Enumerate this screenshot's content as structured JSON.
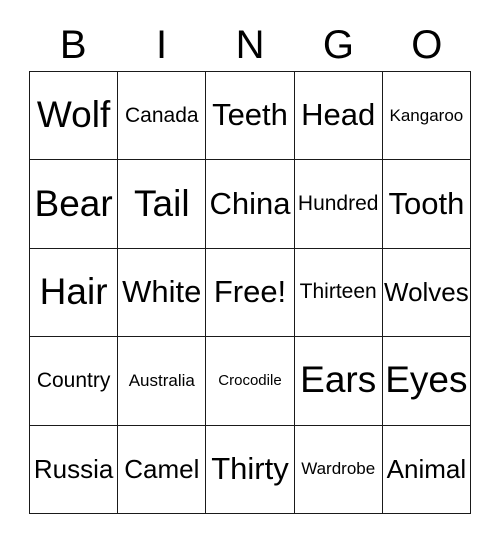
{
  "card": {
    "title": "BINGO",
    "header_letters": [
      "B",
      "I",
      "N",
      "G",
      "O"
    ],
    "border_color": "#1a1a1a",
    "background_color": "#ffffff",
    "text_color": "#000000",
    "columns": 5,
    "rows": 5,
    "free_space_label": "Free!",
    "cells": [
      [
        {
          "label": "Wolf",
          "size": "fs-xl"
        },
        {
          "label": "Canada",
          "size": "fs-sm"
        },
        {
          "label": "Teeth",
          "size": "fs-lg"
        },
        {
          "label": "Head",
          "size": "fs-lg"
        },
        {
          "label": "Kangaroo",
          "size": "fs-xs"
        }
      ],
      [
        {
          "label": "Bear",
          "size": "fs-xl"
        },
        {
          "label": "Tail",
          "size": "fs-xl"
        },
        {
          "label": "China",
          "size": "fs-lg"
        },
        {
          "label": "Hundred",
          "size": "fs-sm"
        },
        {
          "label": "Tooth",
          "size": "fs-lg"
        }
      ],
      [
        {
          "label": "Hair",
          "size": "fs-xl"
        },
        {
          "label": "White",
          "size": "fs-lg"
        },
        {
          "label": "Free!",
          "size": "fs-lg"
        },
        {
          "label": "Thirteen",
          "size": "fs-sm"
        },
        {
          "label": "Wolves",
          "size": "fs-md"
        }
      ],
      [
        {
          "label": "Country",
          "size": "fs-sm"
        },
        {
          "label": "Australia",
          "size": "fs-xs"
        },
        {
          "label": "Crocodile",
          "size": "fs-xxs"
        },
        {
          "label": "Ears",
          "size": "fs-xl"
        },
        {
          "label": "Eyes",
          "size": "fs-xl"
        }
      ],
      [
        {
          "label": "Russia",
          "size": "fs-md"
        },
        {
          "label": "Camel",
          "size": "fs-md"
        },
        {
          "label": "Thirty",
          "size": "fs-lg"
        },
        {
          "label": "Wardrobe",
          "size": "fs-xs"
        },
        {
          "label": "Animal",
          "size": "fs-md"
        }
      ]
    ]
  }
}
